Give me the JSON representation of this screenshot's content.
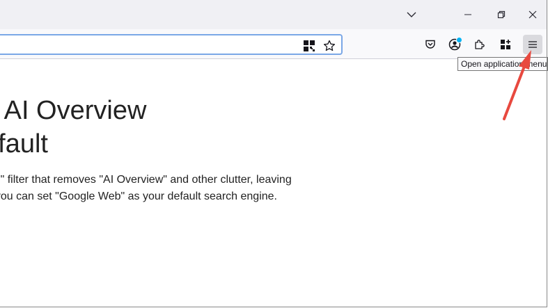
{
  "window": {
    "controls": [
      "list-all-tabs",
      "minimize",
      "restore",
      "close"
    ]
  },
  "navbar": {
    "url_value": "",
    "icons": [
      "qr-code-icon",
      "bookmark-star-icon",
      "pocket-icon",
      "account-icon",
      "extensions-icon",
      "add-ons-grid-icon",
      "hamburger-menu-icon"
    ]
  },
  "tooltip": {
    "text": "Open application menu"
  },
  "article": {
    "headline_line1": "e AI Overview",
    "headline_line2": "efault",
    "paragraph_line1": "Web\" filter that removes \"AI Overview\" and other clutter, leaving",
    "paragraph_line2": "ow you can set \"Google Web\" as your default search engine."
  },
  "annotation": {
    "arrow_color": "#e8493f"
  },
  "colors": {
    "titlebar": "#f0f0f4",
    "navbar": "#f9f9fb",
    "focus_ring": "#7aa7e6",
    "badge": "#00b3f4"
  }
}
